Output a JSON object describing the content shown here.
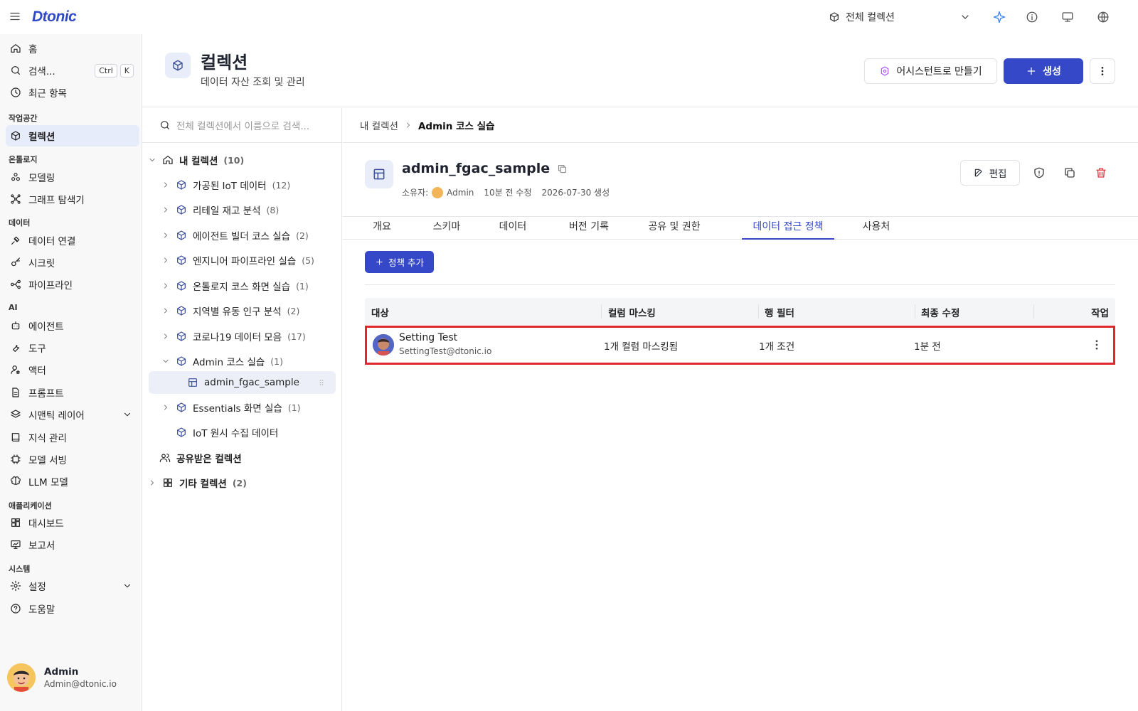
{
  "app": {
    "logo": "Dtonic"
  },
  "topbar": {
    "scope_label": "전체 컬렉션"
  },
  "sidebar": {
    "search_label": "검색...",
    "search_kbd": [
      "Ctrl",
      "K"
    ],
    "top_items": [
      {
        "label": "홈",
        "icon": "home-icon"
      },
      {
        "label": "검색...",
        "icon": "search-icon"
      },
      {
        "label": "최근 항목",
        "icon": "clock-icon"
      }
    ],
    "sections": [
      {
        "title": "작업공간",
        "items": [
          {
            "label": "컬렉션",
            "icon": "cube-icon",
            "active": true
          }
        ]
      },
      {
        "title": "온톨로지",
        "items": [
          {
            "label": "모델링",
            "icon": "nodes-icon"
          },
          {
            "label": "그래프 탐색기",
            "icon": "graph-icon"
          }
        ]
      },
      {
        "title": "데이터",
        "items": [
          {
            "label": "데이터 연결",
            "icon": "plug-icon"
          },
          {
            "label": "시크릿",
            "icon": "key-icon"
          },
          {
            "label": "파이프라인",
            "icon": "pipeline-icon"
          }
        ]
      },
      {
        "title": "AI",
        "items": [
          {
            "label": "에이전트",
            "icon": "robot-icon"
          },
          {
            "label": "도구",
            "icon": "wrench-icon"
          },
          {
            "label": "액터",
            "icon": "actor-icon"
          },
          {
            "label": "프롬프트",
            "icon": "document-icon"
          },
          {
            "label": "시맨틱 레이어",
            "icon": "layers-icon"
          },
          {
            "label": "지식 관리",
            "icon": "book-icon"
          },
          {
            "label": "모델 서빙",
            "icon": "chip-icon"
          },
          {
            "label": "LLM 모델",
            "icon": "brain-icon"
          }
        ]
      },
      {
        "title": "애플리케이션",
        "items": [
          {
            "label": "대시보드",
            "icon": "dashboard-icon"
          },
          {
            "label": "보고서",
            "icon": "report-icon"
          }
        ]
      },
      {
        "title": "시스템",
        "items": [
          {
            "label": "설정",
            "icon": "gear-icon"
          },
          {
            "label": "도움말",
            "icon": "help-icon"
          }
        ]
      }
    ],
    "user": {
      "name": "Admin",
      "email": "Admin@dtonic.io"
    }
  },
  "header": {
    "title": "컬렉션",
    "subtitle": "데이터 자산 조회 및 관리",
    "assist_label": "어시스턴트로 만들기",
    "create_label": "생성"
  },
  "tree": {
    "search_placeholder": "전체 컬렉션에서 이름으로 검색...",
    "root": {
      "label": "내 컬렉션",
      "count": "(10)"
    },
    "items": [
      {
        "label": "가공된 IoT 데이터",
        "count": "(12)"
      },
      {
        "label": "리테일 재고 분석",
        "count": "(8)"
      },
      {
        "label": "에이전트 빌더 코스 실습",
        "count": "(2)"
      },
      {
        "label": "엔지니어 파이프라인 실습",
        "count": "(5)"
      },
      {
        "label": "온톨로지 코스 화면 실습",
        "count": "(1)"
      },
      {
        "label": "지역별 유동 인구 분석",
        "count": "(2)"
      },
      {
        "label": "코로나19 데이터 모음",
        "count": "(17)"
      },
      {
        "label": "Admin 코스 실습",
        "count": "(1)"
      }
    ],
    "child": {
      "label": "admin_fgac_sample"
    },
    "items2": [
      {
        "label": "Essentials 화면 실습",
        "count": "(1)"
      },
      {
        "label": "IoT 원시 수집 데이터",
        "count": ""
      }
    ],
    "shared": {
      "label": "공유받은 컬렉션"
    },
    "other": {
      "label": "기타 컬렉션",
      "count": "(2)"
    }
  },
  "main": {
    "breadcrumb": [
      "내 컬렉션",
      "Admin 코스 실습"
    ],
    "dataset": {
      "name": "admin_fgac_sample",
      "owner_label": "소유자:",
      "owner": "Admin",
      "modified": "10분 전 수정",
      "created": "2026-07-30 생성"
    },
    "edit_label": "편집",
    "tabs": [
      "개요",
      "스키마",
      "데이터",
      "버전 기록",
      "공유 및 권한",
      "데이터 접근 정책",
      "사용처"
    ],
    "active_tab": "데이터 접근 정책",
    "add_policy_label": "정책 추가",
    "table": {
      "columns": [
        "대상",
        "컬럼 마스킹",
        "행 필터",
        "최종 수정",
        "작업"
      ],
      "rows": [
        {
          "name": "Setting Test",
          "email": "SettingTest@dtonic.io",
          "masking": "1개 컬럼 마스킹됨",
          "filter": "1개 조건",
          "modified": "1분 전"
        }
      ]
    }
  },
  "colors": {
    "accent": "#3549c8",
    "highlight": "#e1272d",
    "danger": "#e0343a"
  }
}
